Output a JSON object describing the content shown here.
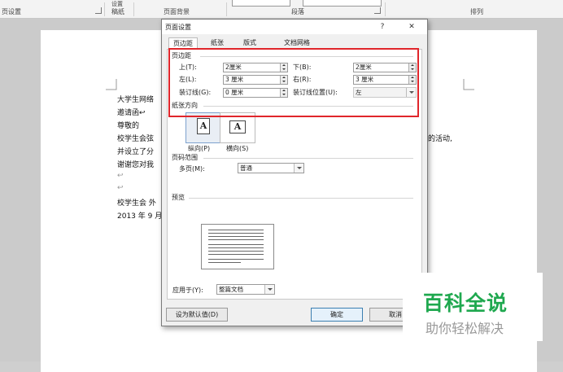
{
  "ribbon": {
    "page_setup_group": "页设置",
    "manuscript": "稿纸",
    "page_background": "页面背景",
    "paragraph": "段落",
    "arrange": "排列",
    "setting_top": "设置"
  },
  "document": {
    "lines": [
      "大学生网络",
      "邀请函↩",
      "尊敬的",
      "校学生会弦",
      "并设立了分",
      "谢谢您对我",
      "↩",
      "↩",
      "校学生会 外",
      "2013 年 9 月"
    ],
    "right_fragment": "的活动,"
  },
  "dialog": {
    "title": "页面设置",
    "help": "?",
    "close": "✕",
    "tabs": [
      "页边距",
      "纸张",
      "版式",
      "文档网格"
    ],
    "margins": {
      "section_label": "页边距",
      "top_label": "上(T):",
      "top_value": "2厘米",
      "bottom_label": "下(B):",
      "bottom_value": "2厘米",
      "left_label": "左(L):",
      "left_value": "3 厘米",
      "right_label": "右(R):",
      "right_value": "3 厘米",
      "gutter_label": "装订线(G):",
      "gutter_value": "0 厘米",
      "gutter_pos_label": "装订线位置(U):",
      "gutter_pos_value": "左"
    },
    "orientation": {
      "section_label": "纸张方向",
      "portrait_label": "纵向(P)",
      "landscape_label": "横向(S)",
      "icon_letter": "A",
      "selected": "portrait"
    },
    "pages": {
      "section_label": "页码范围",
      "multiple_label": "多页(M):",
      "multiple_value": "普通"
    },
    "preview": {
      "section_label": "预览"
    },
    "apply": {
      "label": "应用于(Y):",
      "value": "整篇文档"
    },
    "buttons": {
      "set_default": "设为默认值(D)",
      "ok": "确定",
      "cancel": "取消"
    }
  },
  "watermark": {
    "logo": "百科全说",
    "subtitle": "助你轻松解决"
  },
  "colors": {
    "highlight_border": "#e0262b",
    "watermark_green": "#1fa84f"
  }
}
